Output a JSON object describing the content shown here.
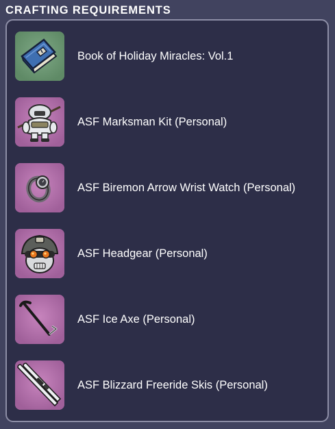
{
  "header": {
    "title": "CRAFTING REQUIREMENTS"
  },
  "colors": {
    "page_background": "#41435f",
    "panel_background": "#2d2e48",
    "panel_border": "#8d8ea6",
    "book_tile": "#6d9872",
    "personal_tile": "#b070a8",
    "text": "#ffffff"
  },
  "requirements": [
    {
      "name": "Book of Holiday Miracles: Vol.1",
      "icon": "blue-book-icon",
      "tile_color": "#6d9872"
    },
    {
      "name": "ASF Marksman Kit (Personal)",
      "icon": "marksman-kit-icon",
      "tile_color": "#b070a8"
    },
    {
      "name": "ASF Biremon Arrow Wrist Watch (Personal)",
      "icon": "wrist-watch-icon",
      "tile_color": "#b070a8"
    },
    {
      "name": "ASF Headgear (Personal)",
      "icon": "headgear-icon",
      "tile_color": "#b070a8"
    },
    {
      "name": "ASF Ice Axe (Personal)",
      "icon": "ice-axe-icon",
      "tile_color": "#b070a8"
    },
    {
      "name": "ASF Blizzard Freeride Skis (Personal)",
      "icon": "skis-icon",
      "tile_color": "#b070a8"
    }
  ]
}
